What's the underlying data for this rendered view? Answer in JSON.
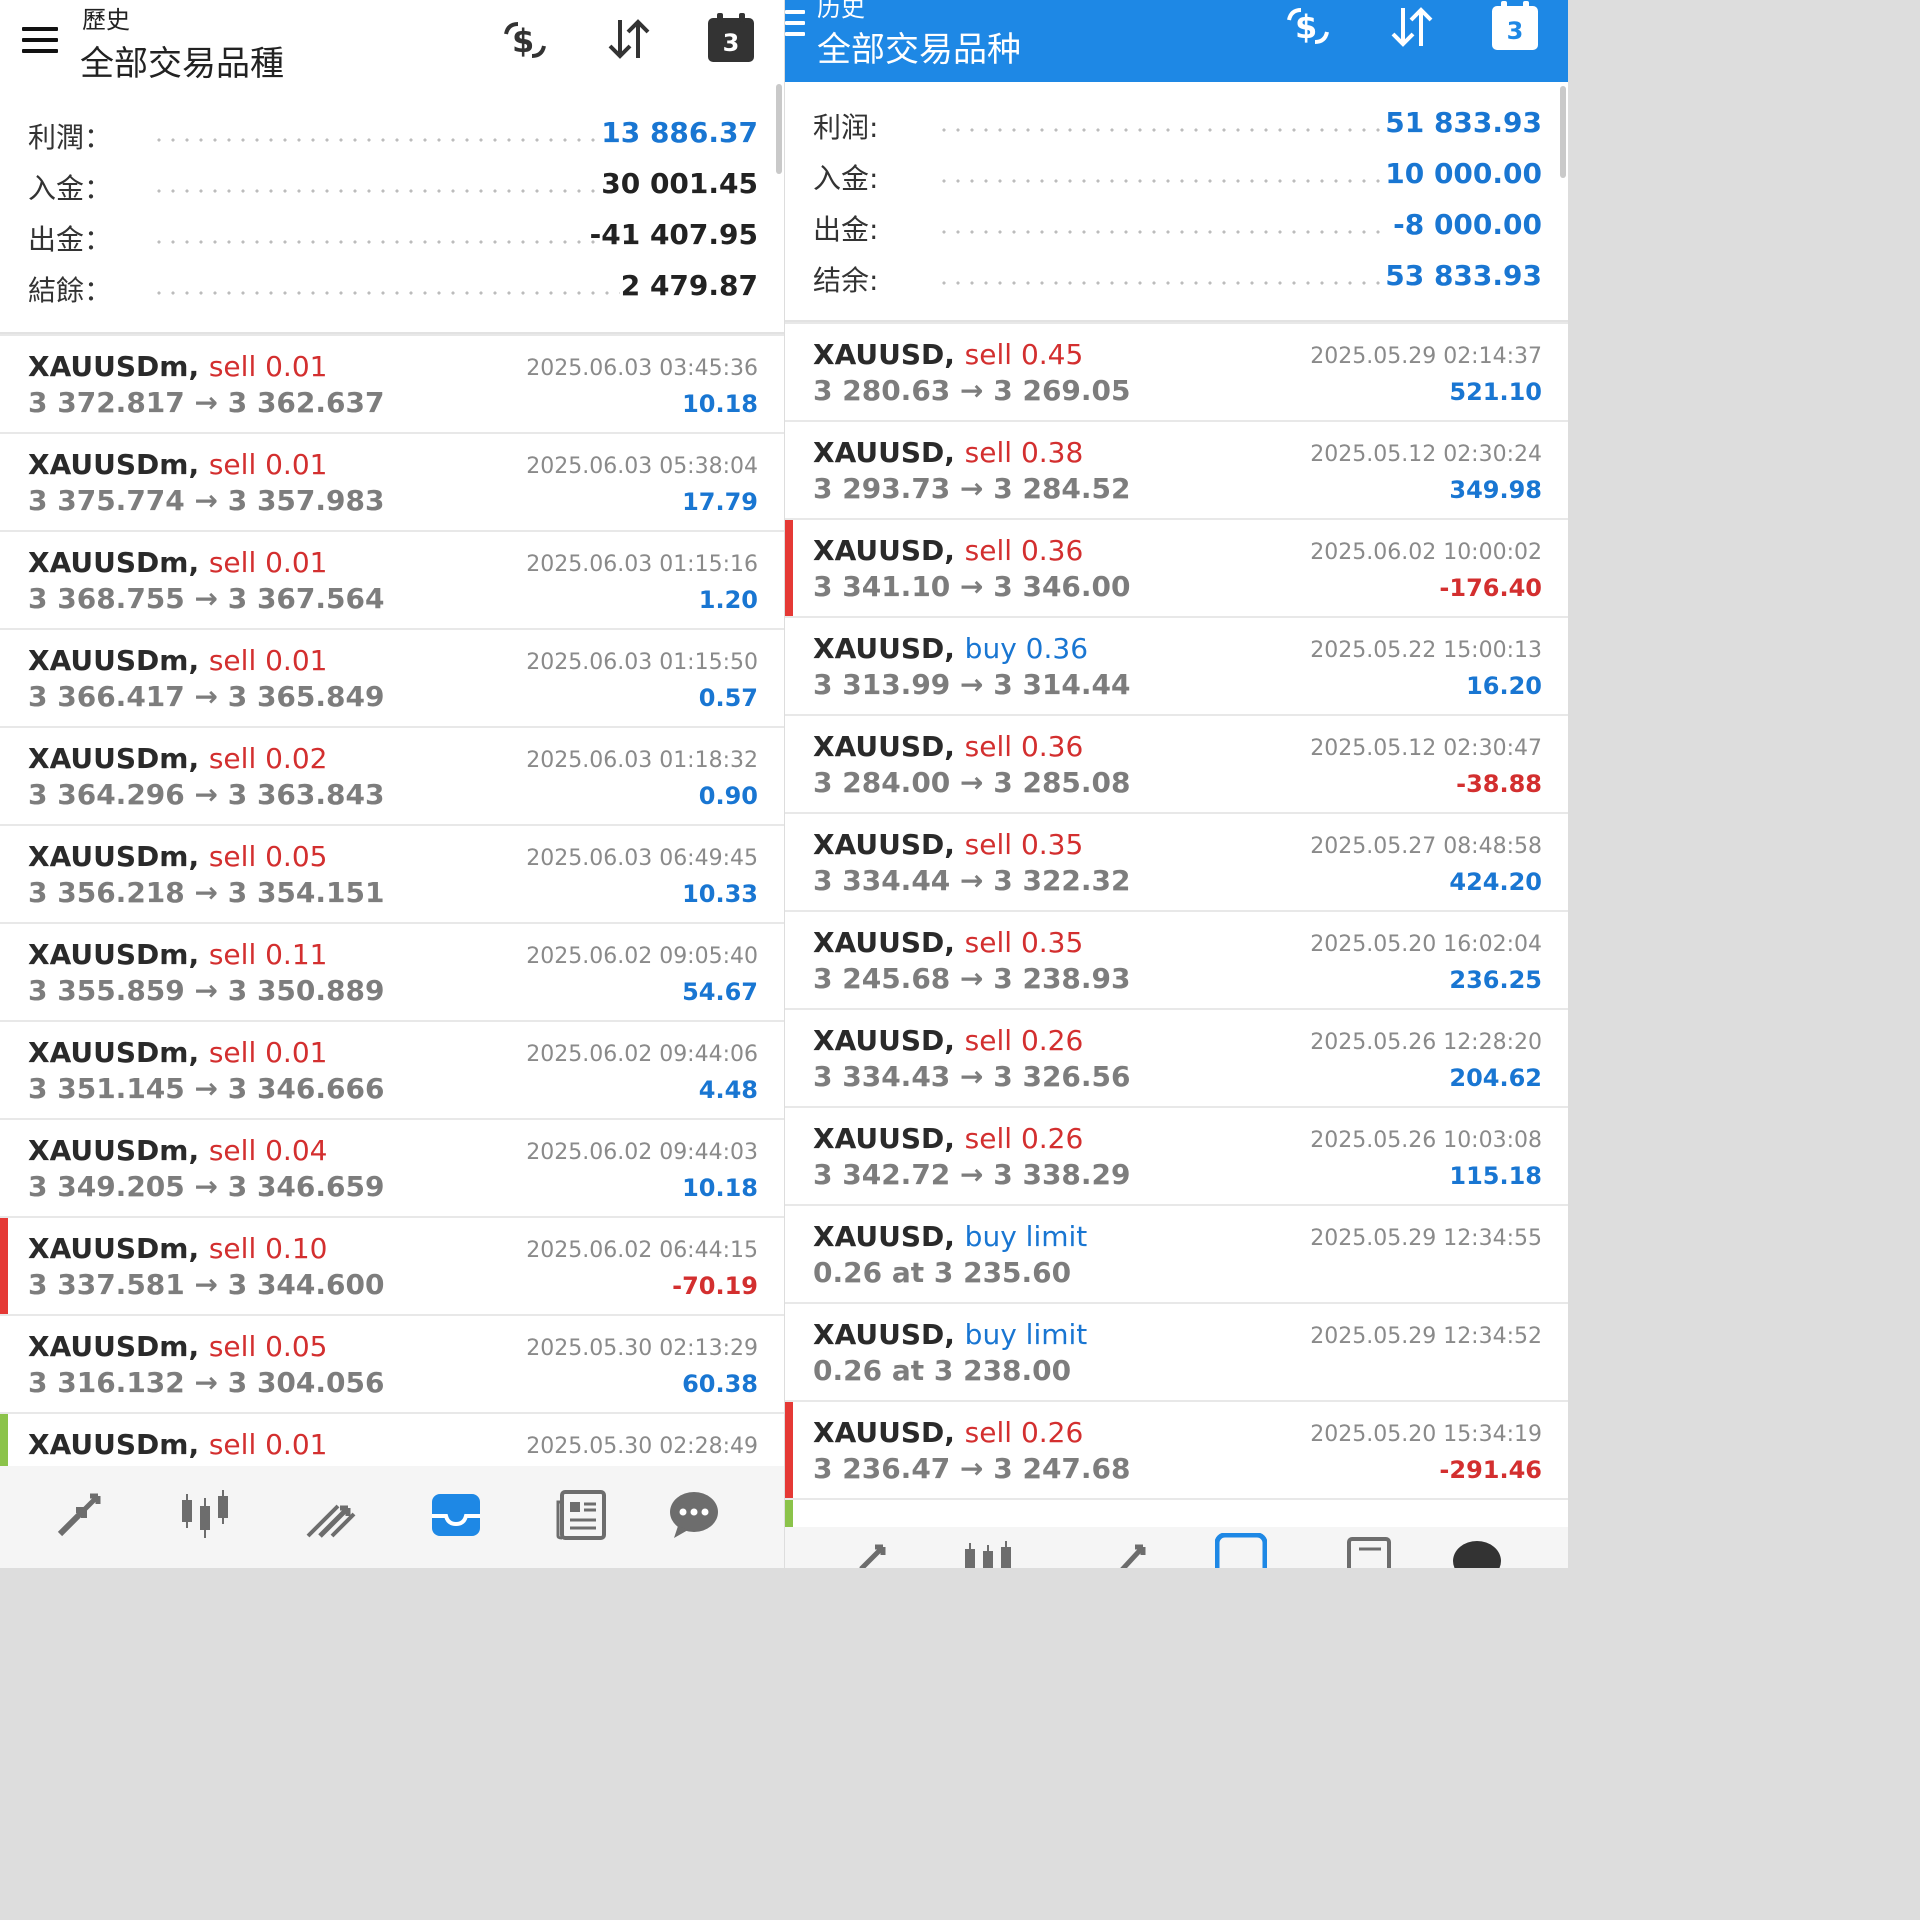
{
  "left": {
    "header": {
      "subtitle": "歷史",
      "title": "全部交易品種",
      "calendar_day": "3"
    },
    "summary": [
      {
        "label": "利潤：",
        "value": "13 886.37",
        "color": "blue"
      },
      {
        "label": "入金：",
        "value": "30 001.45",
        "color": "dark"
      },
      {
        "label": "出金：",
        "value": "-41 407.95",
        "color": "dark"
      },
      {
        "label": "結餘：",
        "value": "2 479.87",
        "color": "dark"
      }
    ],
    "trades": [
      {
        "symbol": "XAUUSDm,",
        "side": "sell",
        "side_text": "sell 0.01",
        "prices": "3 372.817 → 3 362.637",
        "time": "2025.06.03 03:45:36",
        "profit": "10.18",
        "sign": "pos",
        "marker": ""
      },
      {
        "symbol": "XAUUSDm,",
        "side": "sell",
        "side_text": "sell 0.01",
        "prices": "3 375.774 → 3 357.983",
        "time": "2025.06.03 05:38:04",
        "profit": "17.79",
        "sign": "pos",
        "marker": ""
      },
      {
        "symbol": "XAUUSDm,",
        "side": "sell",
        "side_text": "sell 0.01",
        "prices": "3 368.755 → 3 367.564",
        "time": "2025.06.03 01:15:16",
        "profit": "1.20",
        "sign": "pos",
        "marker": ""
      },
      {
        "symbol": "XAUUSDm,",
        "side": "sell",
        "side_text": "sell 0.01",
        "prices": "3 366.417 → 3 365.849",
        "time": "2025.06.03 01:15:50",
        "profit": "0.57",
        "sign": "pos",
        "marker": ""
      },
      {
        "symbol": "XAUUSDm,",
        "side": "sell",
        "side_text": "sell 0.02",
        "prices": "3 364.296 → 3 363.843",
        "time": "2025.06.03 01:18:32",
        "profit": "0.90",
        "sign": "pos",
        "marker": ""
      },
      {
        "symbol": "XAUUSDm,",
        "side": "sell",
        "side_text": "sell 0.05",
        "prices": "3 356.218 → 3 354.151",
        "time": "2025.06.03 06:49:45",
        "profit": "10.33",
        "sign": "pos",
        "marker": ""
      },
      {
        "symbol": "XAUUSDm,",
        "side": "sell",
        "side_text": "sell 0.11",
        "prices": "3 355.859 → 3 350.889",
        "time": "2025.06.02 09:05:40",
        "profit": "54.67",
        "sign": "pos",
        "marker": ""
      },
      {
        "symbol": "XAUUSDm,",
        "side": "sell",
        "side_text": "sell 0.01",
        "prices": "3 351.145 → 3 346.666",
        "time": "2025.06.02 09:44:06",
        "profit": "4.48",
        "sign": "pos",
        "marker": ""
      },
      {
        "symbol": "XAUUSDm,",
        "side": "sell",
        "side_text": "sell 0.04",
        "prices": "3 349.205 → 3 346.659",
        "time": "2025.06.02 09:44:03",
        "profit": "10.18",
        "sign": "pos",
        "marker": ""
      },
      {
        "symbol": "XAUUSDm,",
        "side": "sell",
        "side_text": "sell 0.10",
        "prices": "3 337.581 → 3 344.600",
        "time": "2025.06.02 06:44:15",
        "profit": "-70.19",
        "sign": "neg",
        "marker": "red"
      },
      {
        "symbol": "XAUUSDm,",
        "side": "sell",
        "side_text": "sell 0.05",
        "prices": "3 316.132 → 3 304.056",
        "time": "2025.05.30 02:13:29",
        "profit": "60.38",
        "sign": "pos",
        "marker": ""
      },
      {
        "symbol": "XAUUSDm,",
        "side": "sell",
        "side_text": "sell 0.01",
        "prices": "",
        "time": "2025.05.30 02:28:49",
        "profit": "",
        "sign": "pos",
        "marker": "green"
      }
    ]
  },
  "right": {
    "header": {
      "subtitle": "历史",
      "title": "全部交易品种",
      "calendar_day": "3"
    },
    "summary": [
      {
        "label": "利润:",
        "value": "51 833.93",
        "color": "blue"
      },
      {
        "label": "入金:",
        "value": "10 000.00",
        "color": "blue"
      },
      {
        "label": "出金:",
        "value": "-8 000.00",
        "color": "blue"
      },
      {
        "label": "结余:",
        "value": "53 833.93",
        "color": "blue"
      }
    ],
    "trades": [
      {
        "symbol": "XAUUSD,",
        "side": "sell",
        "side_text": "sell 0.45",
        "prices": "3 280.63 → 3 269.05",
        "time": "2025.05.29 02:14:37",
        "profit": "521.10",
        "sign": "pos",
        "marker": ""
      },
      {
        "symbol": "XAUUSD,",
        "side": "sell",
        "side_text": "sell 0.38",
        "prices": "3 293.73 → 3 284.52",
        "time": "2025.05.12 02:30:24",
        "profit": "349.98",
        "sign": "pos",
        "marker": ""
      },
      {
        "symbol": "XAUUSD,",
        "side": "sell",
        "side_text": "sell 0.36",
        "prices": "3 341.10 → 3 346.00",
        "time": "2025.06.02 10:00:02",
        "profit": "-176.40",
        "sign": "neg",
        "marker": "red"
      },
      {
        "symbol": "XAUUSD,",
        "side": "buy",
        "side_text": "buy 0.36",
        "prices": "3 313.99 → 3 314.44",
        "time": "2025.05.22 15:00:13",
        "profit": "16.20",
        "sign": "pos",
        "marker": ""
      },
      {
        "symbol": "XAUUSD,",
        "side": "sell",
        "side_text": "sell 0.36",
        "prices": "3 284.00 → 3 285.08",
        "time": "2025.05.12 02:30:47",
        "profit": "-38.88",
        "sign": "neg",
        "marker": ""
      },
      {
        "symbol": "XAUUSD,",
        "side": "sell",
        "side_text": "sell 0.35",
        "prices": "3 334.44 → 3 322.32",
        "time": "2025.05.27 08:48:58",
        "profit": "424.20",
        "sign": "pos",
        "marker": ""
      },
      {
        "symbol": "XAUUSD,",
        "side": "sell",
        "side_text": "sell 0.35",
        "prices": "3 245.68 → 3 238.93",
        "time": "2025.05.20 16:02:04",
        "profit": "236.25",
        "sign": "pos",
        "marker": ""
      },
      {
        "symbol": "XAUUSD,",
        "side": "sell",
        "side_text": "sell 0.26",
        "prices": "3 334.43 → 3 326.56",
        "time": "2025.05.26 12:28:20",
        "profit": "204.62",
        "sign": "pos",
        "marker": ""
      },
      {
        "symbol": "XAUUSD,",
        "side": "sell",
        "side_text": "sell 0.26",
        "prices": "3 342.72 → 3 338.29",
        "time": "2025.05.26 10:03:08",
        "profit": "115.18",
        "sign": "pos",
        "marker": ""
      },
      {
        "symbol": "XAUUSD,",
        "side": "buy",
        "side_text": "buy limit",
        "prices": "0.26 at 3 235.60",
        "time": "2025.05.29 12:34:55",
        "profit": "",
        "sign": "pos",
        "marker": ""
      },
      {
        "symbol": "XAUUSD,",
        "side": "buy",
        "side_text": "buy limit",
        "prices": "0.26 at 3 238.00",
        "time": "2025.05.29 12:34:52",
        "profit": "",
        "sign": "pos",
        "marker": ""
      },
      {
        "symbol": "XAUUSD,",
        "side": "sell",
        "side_text": "sell 0.26",
        "prices": "3 236.47 → 3 247.68",
        "time": "2025.05.20 15:34:19",
        "profit": "-291.46",
        "sign": "neg",
        "marker": "red"
      },
      {
        "symbol": "",
        "side": "sell",
        "side_text": "",
        "prices": "",
        "time": "",
        "profit": "",
        "sign": "pos",
        "marker": "green"
      }
    ]
  },
  "nav_icons": [
    "quotes-icon",
    "chart-icon",
    "trade-icon",
    "history-icon",
    "news-icon",
    "chat-icon"
  ],
  "colors": {
    "accent": "#1e88e5",
    "profit_positive": "#1976d2",
    "profit_negative": "#d32f2f",
    "loss_marker": "#e53935",
    "open_marker": "#8bc34a"
  }
}
